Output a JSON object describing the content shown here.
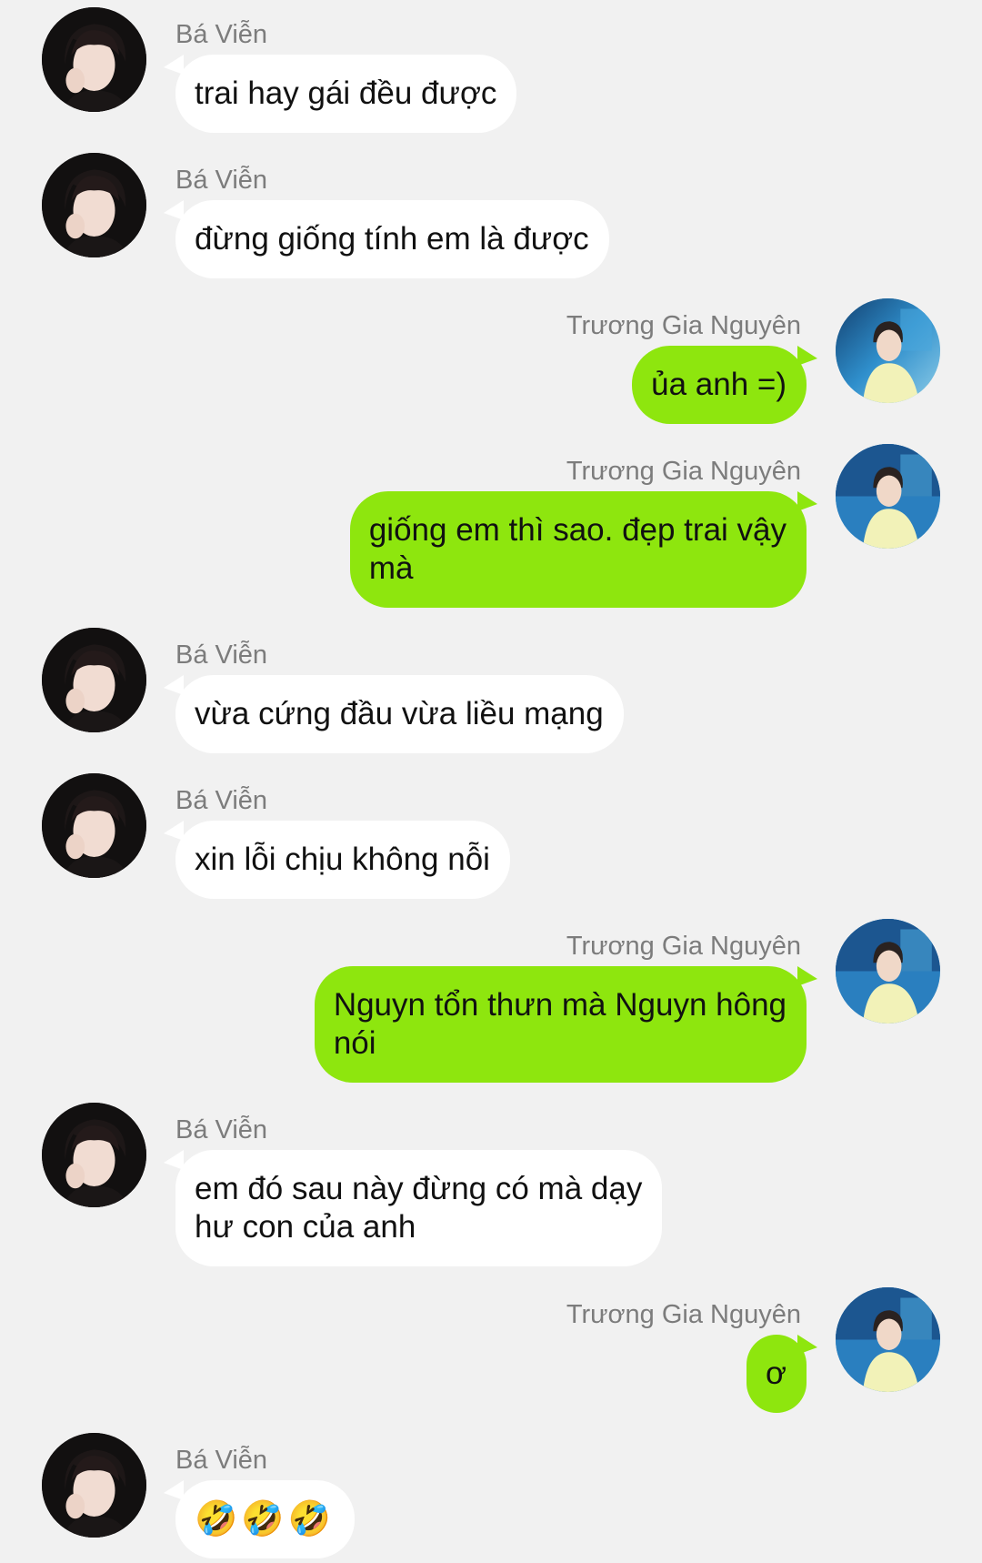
{
  "contacts": {
    "other": "Bá Viễn",
    "self": "Trương Gia Nguyên"
  },
  "messages": [
    {
      "side": "left",
      "sender": "Bá Viễn",
      "text": "trai hay gái đều được"
    },
    {
      "side": "left",
      "sender": "Bá Viễn",
      "text": "đừng giống tính em là được"
    },
    {
      "side": "right",
      "sender": "Trương Gia Nguyên",
      "text": "ủa anh =)"
    },
    {
      "side": "right",
      "sender": "Trương Gia Nguyên",
      "text": "giống em thì sao. đẹp trai vậy\nmà"
    },
    {
      "side": "left",
      "sender": "Bá Viễn",
      "text": "vừa cứng đầu vừa liều mạng"
    },
    {
      "side": "left",
      "sender": "Bá Viễn",
      "text": "xin lỗi chịu không nỗi"
    },
    {
      "side": "right",
      "sender": "Trương Gia Nguyên",
      "text": "Nguyn tổn thưn mà Nguyn hông\nnói"
    },
    {
      "side": "left",
      "sender": "Bá Viễn",
      "text": "em đó sau này đừng có mà dạy\như con của anh"
    },
    {
      "side": "right",
      "sender": "Trương Gia Nguyên",
      "text": "ơ"
    },
    {
      "side": "left",
      "sender": "Bá Viễn",
      "text": "🤣🤣🤣"
    }
  ],
  "colors": {
    "background": "#f1f1f1",
    "outgoing_bubble": "#8ee60e",
    "incoming_bubble": "#ffffff",
    "sender_name": "#7c7c7c"
  },
  "icons": {
    "other_avatar": "avatar-photo-dark",
    "self_avatar": "avatar-photo-blue"
  }
}
